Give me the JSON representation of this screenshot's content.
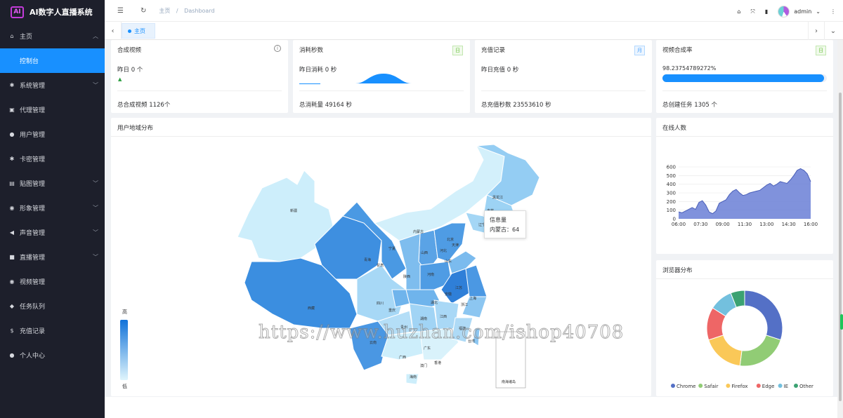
{
  "app": {
    "logo_text": "AI",
    "title": "AI数字人直播系统"
  },
  "sidebar": {
    "items": [
      {
        "label": "主页",
        "icon": "home-icon",
        "glyph": "⌂",
        "arrow": "up"
      },
      {
        "label": "控制台",
        "sub": true,
        "active": true
      },
      {
        "label": "系统管理",
        "icon": "gear-icon",
        "glyph": "✱",
        "arrow": "down"
      },
      {
        "label": "代理管理",
        "icon": "store-icon",
        "glyph": "▣",
        "arrow": ""
      },
      {
        "label": "用户管理",
        "icon": "user-icon",
        "glyph": "●",
        "arrow": ""
      },
      {
        "label": "卡密管理",
        "icon": "asterisk-icon",
        "glyph": "✱",
        "arrow": ""
      },
      {
        "label": "贴图管理",
        "icon": "image-icon",
        "glyph": "▤",
        "arrow": "down"
      },
      {
        "label": "形象管理",
        "icon": "gauge-icon",
        "glyph": "◉",
        "arrow": "down"
      },
      {
        "label": "声音管理",
        "icon": "volume-icon",
        "glyph": "◀",
        "arrow": "down"
      },
      {
        "label": "直播管理",
        "icon": "video-icon",
        "glyph": "■",
        "arrow": "down"
      },
      {
        "label": "视频管理",
        "icon": "play-circle-icon",
        "glyph": "◉",
        "arrow": ""
      },
      {
        "label": "任务队列",
        "icon": "tag-icon",
        "glyph": "◆",
        "arrow": ""
      },
      {
        "label": "充值记录",
        "icon": "dollar-icon",
        "glyph": "$",
        "arrow": ""
      },
      {
        "label": "个人中心",
        "icon": "account-icon",
        "glyph": "●",
        "arrow": ""
      }
    ]
  },
  "topbar": {
    "breadcrumb": [
      "主页",
      "Dashboard"
    ],
    "breadcrumb_sep": "/",
    "username": "admin"
  },
  "tabs": [
    {
      "label": "主页"
    }
  ],
  "stats": [
    {
      "title": "合成视频",
      "badge": "",
      "line": "昨日 0 个",
      "footer": "总合成视频 1126个"
    },
    {
      "title": "消耗秒数",
      "badge": "日",
      "badge_color": "#67c23a",
      "line": "昨日消耗 0 秒",
      "footer": "总消耗量 49164 秒"
    },
    {
      "title": "充值记录",
      "badge": "月",
      "badge_color": "#409eff",
      "line": "昨日充值 0 秒",
      "footer": "总充值秒数 23553610 秒"
    },
    {
      "title": "视频合成率",
      "badge": "日",
      "badge_color": "#67c23a",
      "line": "98.23754789272%",
      "progress": 0.9824,
      "footer": "总创建任务 1305 个"
    }
  ],
  "map": {
    "title": "用户地域分布",
    "legend_high": "高",
    "legend_low": "低",
    "tooltip_title": "信息量",
    "tooltip_line": "内蒙古：64",
    "provinces": [
      "新疆",
      "西藏",
      "青海",
      "甘肃",
      "内蒙古",
      "黑龙江",
      "吉林",
      "辽宁",
      "宁夏",
      "山西",
      "河北",
      "北京",
      "天津",
      "山东",
      "陕西",
      "河南",
      "四川",
      "重庆",
      "湖北",
      "安徽",
      "江苏",
      "上海",
      "浙江",
      "湖南",
      "江西",
      "贵州",
      "云南",
      "广西",
      "广东",
      "福建",
      "台湾",
      "海南",
      "香港",
      "澳门"
    ],
    "inset_label": "南海诸岛"
  },
  "online": {
    "title": "在线人数",
    "chart_data": {
      "type": "area",
      "x": [
        "06:00",
        "07:30",
        "09:00",
        "11:30",
        "13:00",
        "14:30",
        "16:00"
      ],
      "y_ticks": [
        0,
        100,
        200,
        300,
        400,
        500,
        600
      ],
      "ylim": [
        0,
        600
      ],
      "values": [
        80,
        70,
        90,
        110,
        130,
        110,
        190,
        210,
        160,
        80,
        60,
        90,
        180,
        200,
        220,
        280,
        320,
        340,
        300,
        270,
        280,
        300,
        310,
        320,
        330,
        360,
        390,
        410,
        380,
        400,
        430,
        420,
        410,
        450,
        500,
        560,
        580,
        560,
        520,
        430
      ],
      "color": "#6a7fd6"
    }
  },
  "browser": {
    "title": "浏览器分布",
    "chart_data": {
      "type": "pie",
      "labels": [
        "Chrome",
        "Safair",
        "Firefox",
        "Edge",
        "IE",
        "Other"
      ],
      "values": [
        30,
        22,
        18,
        14,
        10,
        6
      ],
      "colors": [
        "#5470c6",
        "#91cc75",
        "#fac858",
        "#ee6666",
        "#73c0de",
        "#3ba272"
      ]
    }
  },
  "watermark": "https://www.huzhan.com/ishop40708"
}
